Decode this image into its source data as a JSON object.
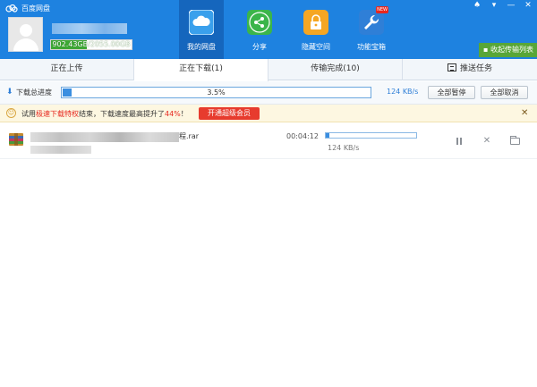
{
  "app": {
    "title": "百度网盘"
  },
  "window_controls": {
    "skin_icon": "♠",
    "settings_icon": "▾",
    "minimize_icon": "—",
    "close_icon": "✕"
  },
  "user": {
    "quota_text": "902.43GB/2055.00GB",
    "quota_used_fraction": 0.439
  },
  "nav": {
    "items": [
      {
        "label": "我的网盘",
        "icon": "cloud-icon",
        "color": "#3aa0ec",
        "active": true
      },
      {
        "label": "分享",
        "icon": "share-icon",
        "color": "#3bb54a"
      },
      {
        "label": "隐藏空间",
        "icon": "lock-icon",
        "color": "#f5a623"
      },
      {
        "label": "功能宝箱",
        "icon": "wrench-icon",
        "color": "#2f7fd7",
        "badge": "NEW"
      }
    ],
    "collapse_label": "收起传输列表"
  },
  "tabs": [
    {
      "label": "正在上传"
    },
    {
      "label": "正在下载(1)",
      "active": true
    },
    {
      "label": "传输完成(10)"
    },
    {
      "label": "推送任务"
    }
  ],
  "progress": {
    "label": "下载总进度",
    "percent_text": "3.5%",
    "fraction": 0.035,
    "speed": "124 KB/s",
    "pause_all": "全部暂停",
    "cancel_all": "全部取消"
  },
  "notice": {
    "prefix": "试用",
    "highlight": "极速下载特权",
    "middle": "结束，下载速度最高提升了",
    "percent": "44%",
    "suffix": "！",
    "button": "开通超级会员"
  },
  "download": {
    "name_suffix": "程.rar",
    "time": "00:04:12",
    "speed": "124 KB/s",
    "fraction": 0.035
  },
  "colors": {
    "header": "#1e82e0",
    "nav_active": "#1566bd",
    "accent_green": "#58a638",
    "quota_green": "#3da835",
    "alert_red": "#e73b2e"
  }
}
